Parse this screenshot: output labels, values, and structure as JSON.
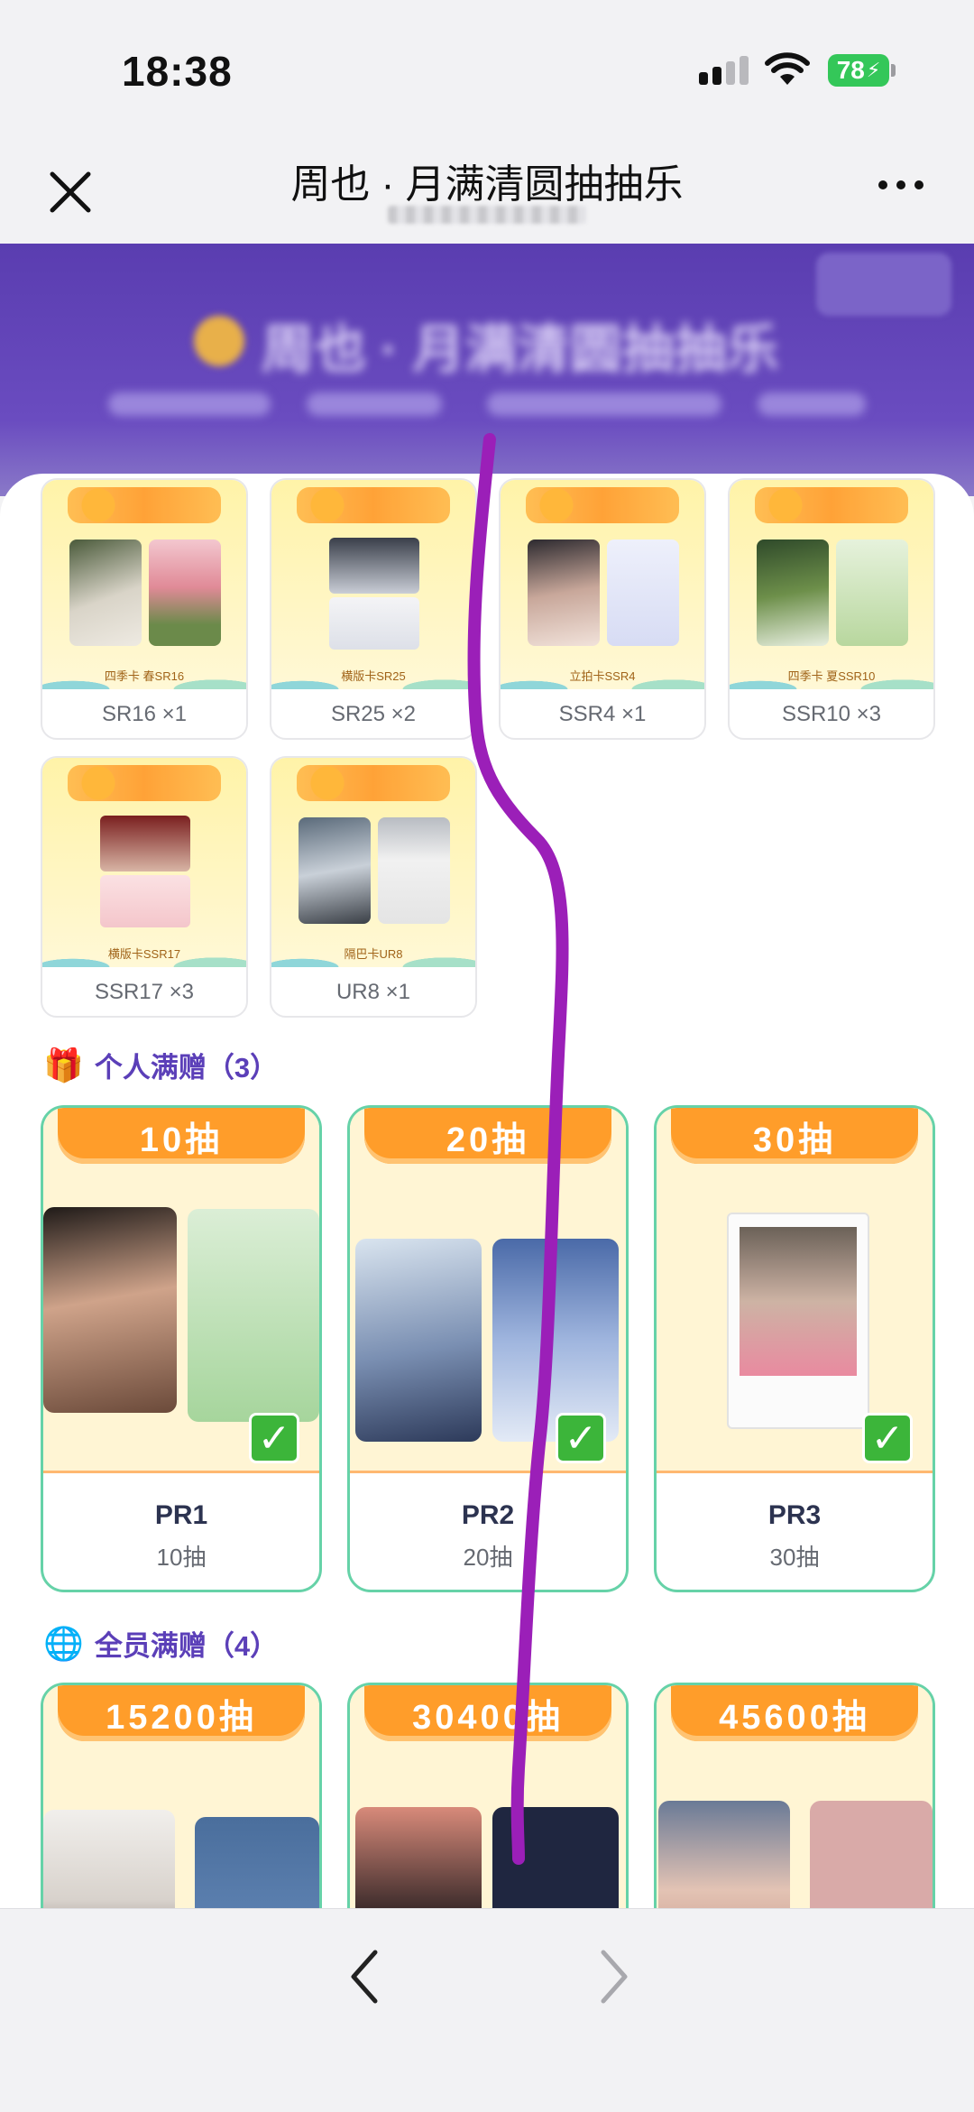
{
  "status_bar": {
    "time": "18:38",
    "battery_level": "78"
  },
  "nav": {
    "title": "周也 · 月满清圆抽抽乐"
  },
  "hero": {
    "title": "周也 · 月满清圆抽抽乐"
  },
  "result_cards": [
    {
      "label": "SR16 ×1",
      "caption": "四季卡 春SR16"
    },
    {
      "label": "SR25 ×2",
      "caption": "横版卡SR25"
    },
    {
      "label": "SSR4 ×1",
      "caption": "立拍卡SSR4"
    },
    {
      "label": "SSR10 ×3",
      "caption": "四季卡 夏SSR10"
    },
    {
      "label": "SSR17 ×3",
      "caption": "横版卡SSR17"
    },
    {
      "label": "UR8 ×1",
      "caption": "隔巴卡UR8"
    }
  ],
  "personal_bonus": {
    "emoji": "🎁",
    "title": "个人满赠（3）",
    "items": [
      {
        "pill": "10抽",
        "code": "PR1",
        "requirement": "10抽",
        "completed": true
      },
      {
        "pill": "20抽",
        "code": "PR2",
        "requirement": "20抽",
        "completed": true
      },
      {
        "pill": "30抽",
        "code": "PR3",
        "requirement": "30抽",
        "completed": true
      }
    ]
  },
  "global_bonus": {
    "emoji": "🌐",
    "title": "全员满赠（4）",
    "items": [
      {
        "pill": "15200抽"
      },
      {
        "pill": "30400抽",
        "hidden_mark": "?"
      },
      {
        "pill": "45600抽",
        "hidden_mark": "?"
      }
    ]
  },
  "toolbar": {
    "back_icon": "chevron-left-icon",
    "forward_icon": "chevron-right-icon"
  },
  "colors": {
    "accent_purple": "#5b3fb8",
    "pill_orange": "#ff9d2a",
    "card_border_green": "#66d2a8",
    "check_green": "#3cb53a",
    "scribble": "#9b1fb8"
  }
}
